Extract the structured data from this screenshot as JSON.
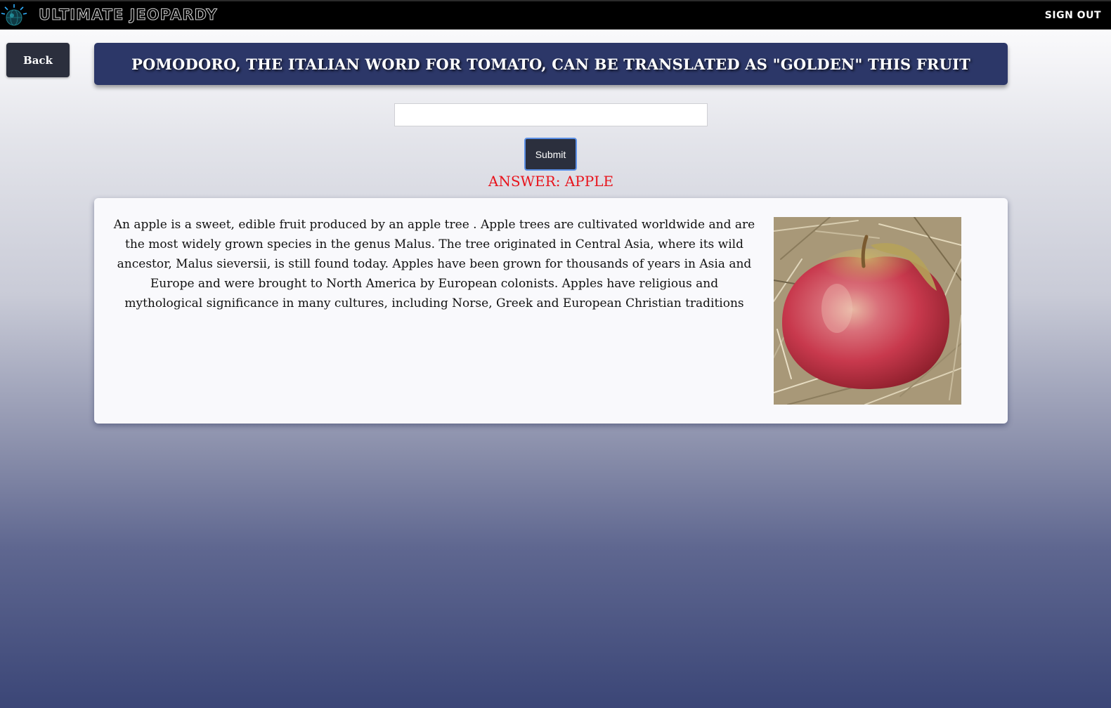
{
  "header": {
    "brand": "ULTIMATE JEOPARDY",
    "sign_out_label": "SIGN OUT",
    "logo_icon": "globe-sparkle-icon"
  },
  "nav": {
    "back_label": "Back"
  },
  "question": {
    "text": "POMODORO, THE ITALIAN WORD FOR TOMATO, CAN BE TRANSLATED AS \"GOLDEN\" THIS FRUIT"
  },
  "answer_form": {
    "input_value": "",
    "input_placeholder": "",
    "submit_label": "Submit"
  },
  "answer": {
    "label": "ANSWER: APPLE"
  },
  "info": {
    "description": "An apple is a sweet, edible fruit produced by an apple tree . Apple trees are cultivated worldwide and are the most widely grown species in the genus Malus. The tree originated in Central Asia, where its wild ancestor, Malus sieversii, is still found today. Apples have been grown for thousands of years in Asia and Europe and were brought to North America by European colonists. Apples have religious and mythological significance in many cultures, including Norse, Greek and European Christian traditions",
    "image_subject": "red apple on straw"
  },
  "colors": {
    "topbar": "#000000",
    "banner": "#2c3768",
    "button": "#2b2f3d",
    "answer_text": "#e8141c",
    "submit_focus": "#5b8fe6"
  }
}
